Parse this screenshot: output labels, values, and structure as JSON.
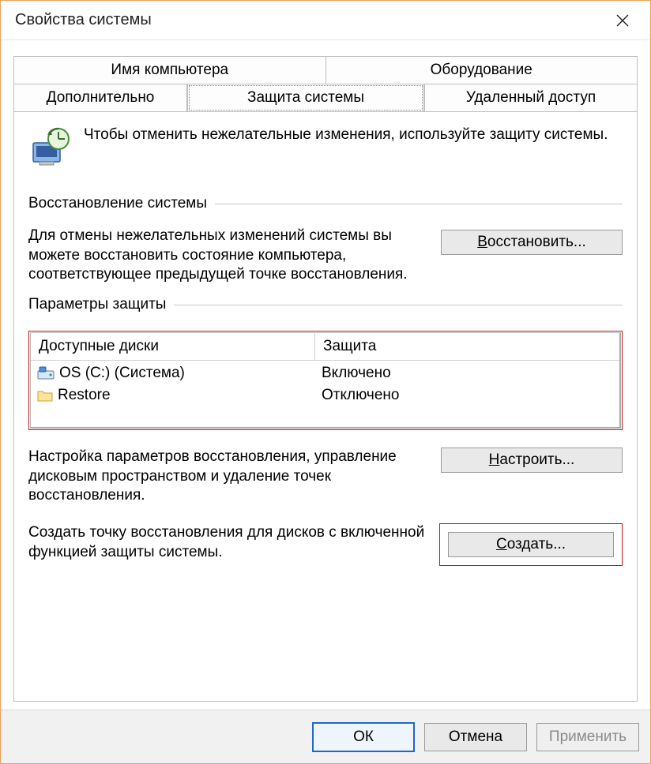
{
  "window": {
    "title": "Свойства системы"
  },
  "tabs": {
    "row1": [
      {
        "label": "Имя компьютера"
      },
      {
        "label": "Оборудование"
      }
    ],
    "row2": [
      {
        "label": "Дополнительно"
      },
      {
        "label": "Защита системы",
        "active": true
      },
      {
        "label": "Удаленный доступ"
      }
    ]
  },
  "intro": "Чтобы отменить нежелательные изменения, используйте защиту системы.",
  "group_restore": {
    "legend": "Восстановление системы",
    "text": "Для отмены нежелательных изменений системы вы можете восстановить состояние компьютера, соответствующее предыдущей точке восстановления.",
    "button": "Восстановить...",
    "button_hotkey": "В"
  },
  "group_settings": {
    "legend": "Параметры защиты",
    "table": {
      "col_drive": "Доступные диски",
      "col_protection": "Защита",
      "rows": [
        {
          "name": "OS (C:) (Система)",
          "protection": "Включено",
          "icon": "system-drive"
        },
        {
          "name": "Restore",
          "protection": "Отключено",
          "icon": "folder"
        }
      ]
    },
    "config_text": "Настройка параметров восстановления, управление дисковым пространством и удаление точек восстановления.",
    "config_button": "Настроить...",
    "config_hotkey": "Н",
    "create_text": "Создать точку восстановления для дисков с включенной функцией защиты системы.",
    "create_button": "Создать...",
    "create_hotkey": "С"
  },
  "dialog_buttons": {
    "ok": "ОК",
    "cancel": "Отмена",
    "apply": "Применить"
  }
}
